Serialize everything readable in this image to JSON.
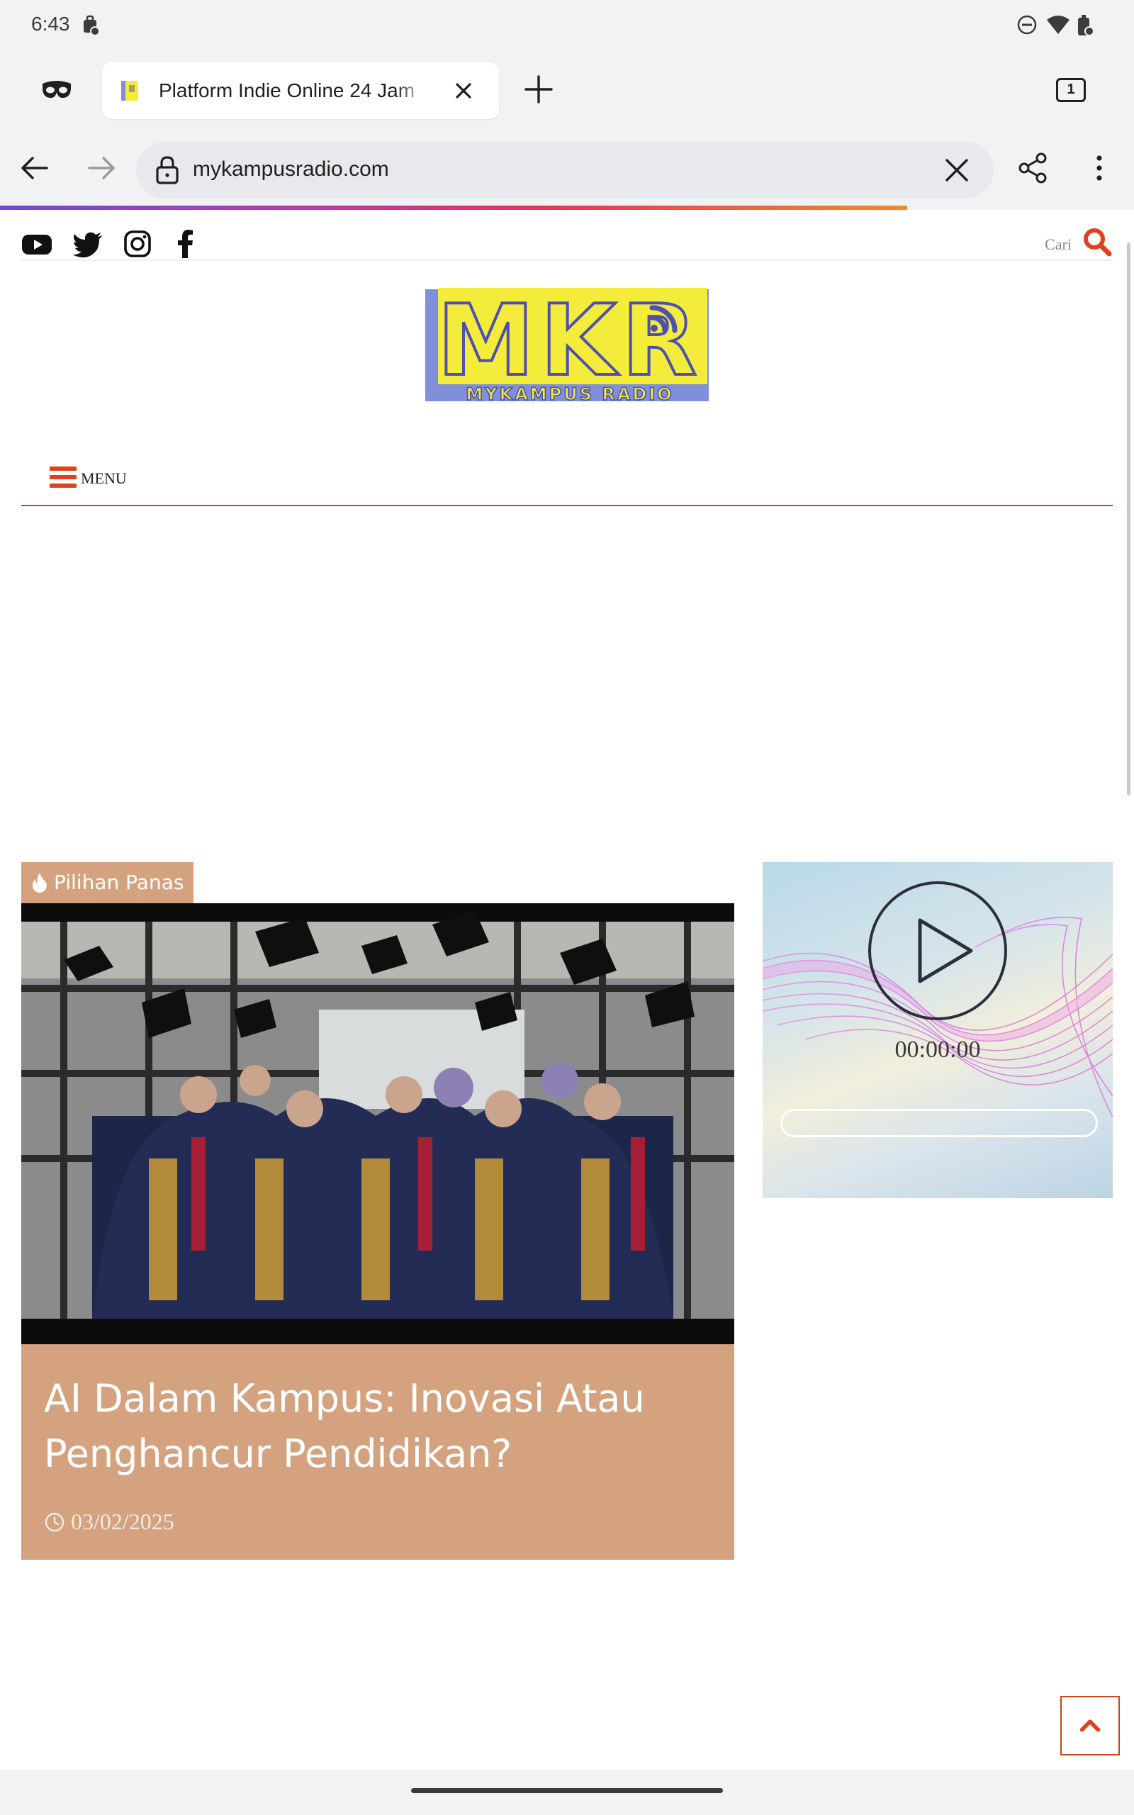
{
  "status_bar": {
    "time": "6:43",
    "icons": [
      "work-profile-icon",
      "do-not-disturb-icon",
      "wifi-icon",
      "battery-icon"
    ]
  },
  "browser": {
    "tab": {
      "title": "Platform Indie Online 24 Jam",
      "favicon": "mkr-favicon"
    },
    "tab_count": "1",
    "url": "mykampusradio.com",
    "load_progress": 0.8,
    "accent_gradient": [
      "#6d4bd6",
      "#e8345a",
      "#f08a2e"
    ]
  },
  "site": {
    "search_label": "Cari",
    "social_icons": [
      "youtube-icon",
      "twitter-icon",
      "instagram-icon",
      "facebook-icon"
    ],
    "logo": {
      "letters": "MKR",
      "subtitle": "MYKAMPUS RADIO",
      "colors": {
        "fill": "#f4ec3a",
        "shadow": "#7f8fd8",
        "text": "#4f4fb0"
      }
    },
    "menu_label": "MENU",
    "accent_color": "#c8441b"
  },
  "featured": {
    "badge": "Pilihan Panas",
    "title": "AI Dalam Kampus: Inovasi Atau Penghancur Pendidikan?",
    "date": "03/02/2025",
    "card_color": "#d4a27e"
  },
  "player": {
    "time": "00:00:00",
    "progress": 0
  }
}
